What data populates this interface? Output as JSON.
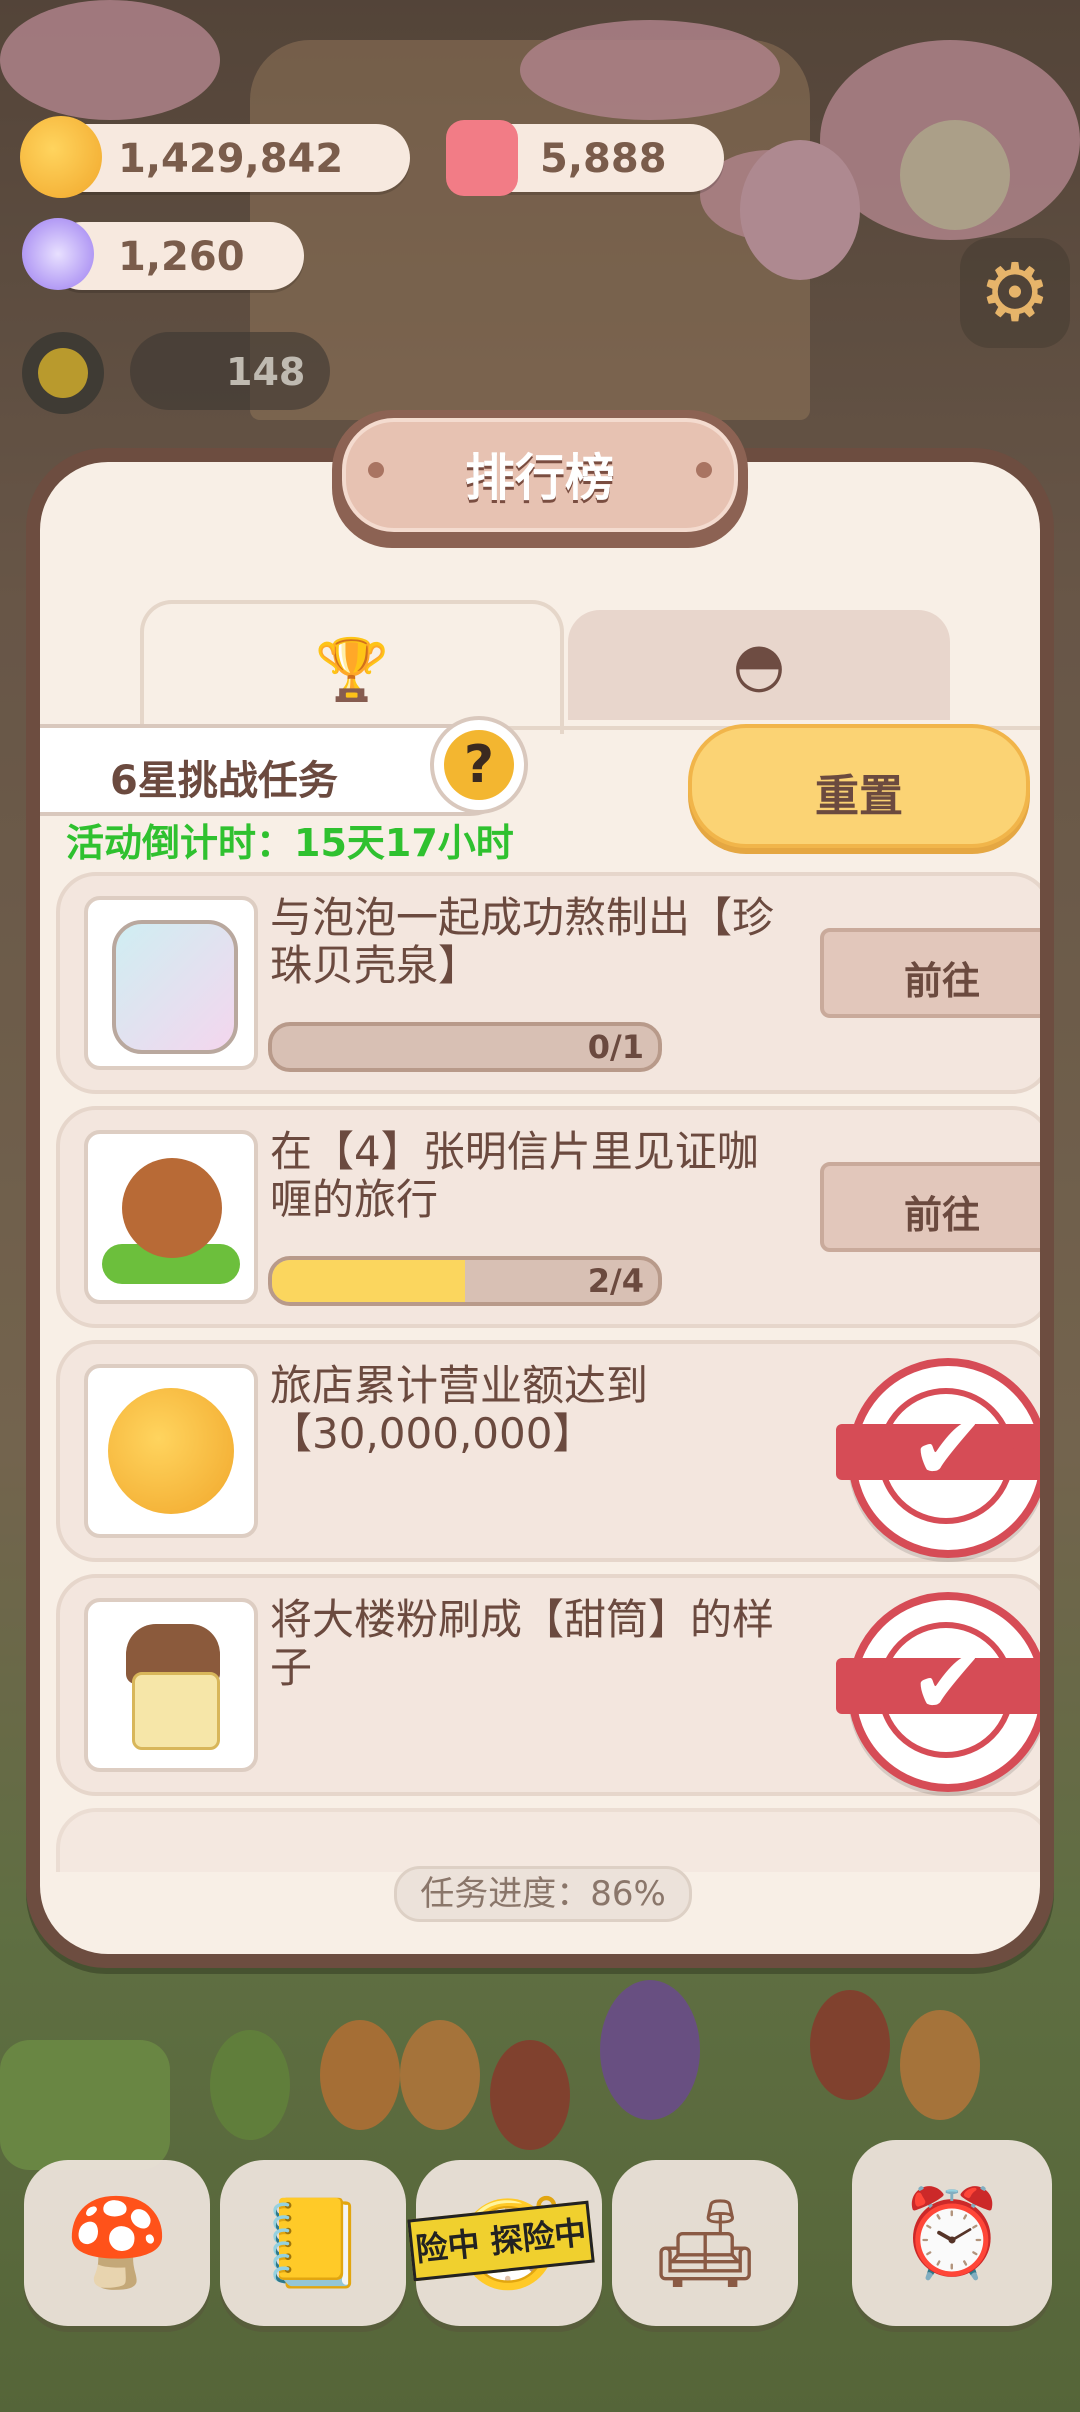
{
  "currencies": {
    "coins": "1,429,842",
    "gems": "5,888",
    "crystals": "1,260",
    "helpers": "148"
  },
  "panel": {
    "title": "排行榜",
    "tabs": [
      {
        "icon": "trophy-icon",
        "active": true
      },
      {
        "icon": "mushroom-icon",
        "active": false
      }
    ],
    "challenge_label": "6星挑战任务",
    "help_symbol": "?",
    "countdown": "活动倒计时：15天17小时",
    "reset_label": "重置",
    "tasks": [
      {
        "text": "与泡泡一起成功熬制出【珍珠贝壳泉】",
        "progress": "0/1",
        "fraction": 0,
        "action": "前往",
        "done": false
      },
      {
        "text": "在【4】张明信片里见证咖喱的旅行",
        "progress": "2/4",
        "fraction": 0.5,
        "action": "前往",
        "done": false
      },
      {
        "text": "旅店累计营业额达到【30,000,000】",
        "done": true
      },
      {
        "text": "将大楼粉刷成【甜筒】的样子",
        "done": true
      }
    ],
    "progress_text": "任务进度：86%"
  },
  "dock": {
    "expedition_tape": "险中 探险中"
  },
  "colors": {
    "panel_border": "#6d4d40",
    "panel_bg": "#f8efe6",
    "countdown_green": "#2fc12f",
    "reset_yellow": "#fbd374",
    "stamp_red": "#d64c56"
  }
}
